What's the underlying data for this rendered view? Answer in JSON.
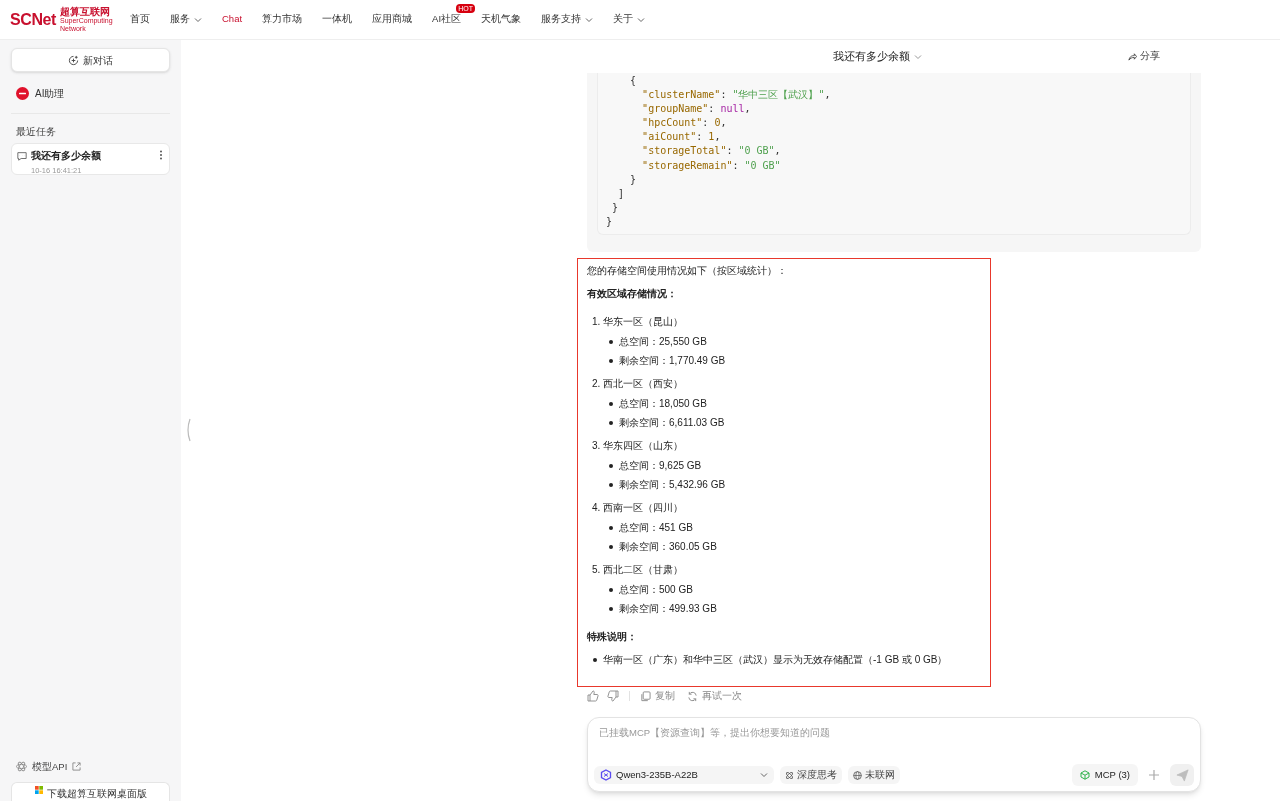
{
  "header": {
    "logo": {
      "wordmark": "SCNet",
      "cn_name": "超算互联网",
      "en_name": "SuperComputing Network"
    },
    "nav": [
      {
        "label": "首页",
        "dropdown": false,
        "selected": false
      },
      {
        "label": "服务",
        "dropdown": true,
        "selected": false
      },
      {
        "label": "Chat",
        "dropdown": false,
        "selected": true
      },
      {
        "label": "算力市场",
        "dropdown": false,
        "selected": false
      },
      {
        "label": "一体机",
        "dropdown": false,
        "selected": false
      },
      {
        "label": "应用商城",
        "dropdown": false,
        "selected": false
      },
      {
        "label": "AI社区",
        "dropdown": false,
        "selected": false,
        "badge": "HOT"
      },
      {
        "label": "天机气象",
        "dropdown": false,
        "selected": false
      },
      {
        "label": "服务支持",
        "dropdown": true,
        "selected": false
      },
      {
        "label": "关于",
        "dropdown": true,
        "selected": false
      }
    ]
  },
  "sidebar": {
    "new_chat": "新对话",
    "assistant": {
      "label": "AI助理"
    },
    "recent_title": "最近任务",
    "tasks": [
      {
        "title": "我还有多少余额",
        "time": "10-16 16:41:21",
        "selected": true
      }
    ],
    "model_api": "模型API",
    "download": "下载超算互联网桌面版"
  },
  "chat": {
    "title": "我还有多少余额",
    "share": "分享",
    "code_lines": [
      [
        {
          "kind": "punct",
          "text": "    {"
        }
      ],
      [
        {
          "kind": "key",
          "text": "      \"clusterName\""
        },
        {
          "kind": "punct",
          "text": ": "
        },
        {
          "kind": "string",
          "text": "\"华中三区【武汉】\""
        },
        {
          "kind": "punct",
          "text": ","
        }
      ],
      [
        {
          "kind": "key",
          "text": "      \"groupName\""
        },
        {
          "kind": "punct",
          "text": ": "
        },
        {
          "kind": "null",
          "text": "null"
        },
        {
          "kind": "punct",
          "text": ","
        }
      ],
      [
        {
          "kind": "key",
          "text": "      \"hpcCount\""
        },
        {
          "kind": "punct",
          "text": ": "
        },
        {
          "kind": "number",
          "text": "0"
        },
        {
          "kind": "punct",
          "text": ","
        }
      ],
      [
        {
          "kind": "key",
          "text": "      \"aiCount\""
        },
        {
          "kind": "punct",
          "text": ": "
        },
        {
          "kind": "number",
          "text": "1"
        },
        {
          "kind": "punct",
          "text": ","
        }
      ],
      [
        {
          "kind": "key",
          "text": "      \"storageTotal\""
        },
        {
          "kind": "punct",
          "text": ": "
        },
        {
          "kind": "string",
          "text": "\"0 GB\""
        },
        {
          "kind": "punct",
          "text": ","
        }
      ],
      [
        {
          "kind": "key",
          "text": "      \"storageRemain\""
        },
        {
          "kind": "punct",
          "text": ": "
        },
        {
          "kind": "string",
          "text": "\"0 GB\""
        }
      ],
      [
        {
          "kind": "punct",
          "text": "    }"
        }
      ],
      [
        {
          "kind": "punct",
          "text": "  ]"
        }
      ],
      [
        {
          "kind": "punct",
          "text": " }"
        }
      ],
      [
        {
          "kind": "punct",
          "text": "}"
        }
      ]
    ],
    "answer": {
      "intro": "您的存储空间使用情况如下（按区域统计）：",
      "section_title": "有效区域存储情况：",
      "regions": [
        {
          "number": "1.",
          "name": "华东一区（昆山）",
          "items": [
            "总空间：25,550 GB",
            "剩余空间：1,770.49 GB"
          ]
        },
        {
          "number": "2.",
          "name": "西北一区（西安）",
          "items": [
            "总空间：18,050 GB",
            "剩余空间：6,611.03 GB"
          ]
        },
        {
          "number": "3.",
          "name": "华东四区（山东）",
          "items": [
            "总空间：9,625 GB",
            "剩余空间：5,432.96 GB"
          ]
        },
        {
          "number": "4.",
          "name": "西南一区（四川）",
          "items": [
            "总空间：451 GB",
            "剩余空间：360.05 GB"
          ]
        },
        {
          "number": "5.",
          "name": "西北二区（甘肃）",
          "items": [
            "总空间：500 GB",
            "剩余空间：499.93 GB"
          ]
        }
      ],
      "note_title": "特殊说明：",
      "notes": [
        "华南一区（广东）和华中三区（武汉）显示为无效存储配置（-1 GB 或 0 GB）"
      ]
    },
    "actions": {
      "copy": "复制",
      "retry": "再试一次"
    },
    "input": {
      "placeholder": "已挂载MCP【资源查询】等，提出你想要知道的问题",
      "model": "Qwen3-235B-A22B",
      "deep_think": "深度思考",
      "web": "未联网",
      "mcp": "MCP (3)"
    }
  }
}
